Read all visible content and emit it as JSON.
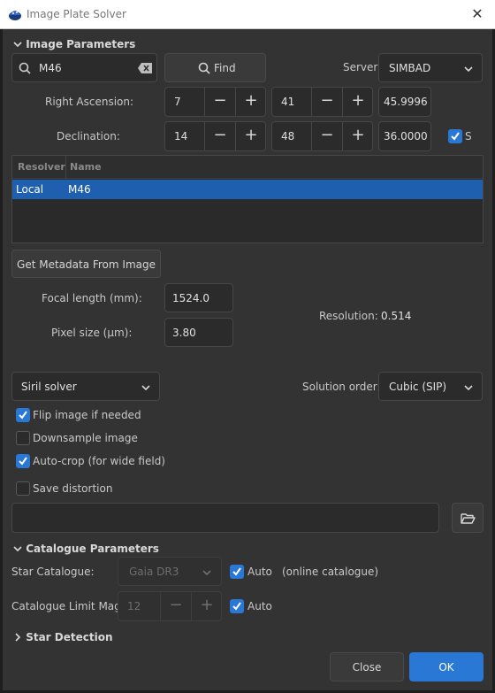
{
  "window": {
    "title": "Image Plate Solver"
  },
  "image_params": {
    "header": "Image Parameters",
    "search_value": "M46",
    "find_label": "Find",
    "server_label": "Server:",
    "server_value": "SIMBAD",
    "ra_label": "Right Ascension:",
    "ra_h": "7",
    "ra_m": "41",
    "ra_s": "45.9996",
    "dec_label": "Declination:",
    "dec_d": "14",
    "dec_m": "48",
    "dec_s": "36.0000",
    "south_label": "S",
    "south_checked": true,
    "table": {
      "columns": [
        "Resolver",
        "Name"
      ],
      "rows": [
        {
          "resolver": "Local",
          "name": "M46"
        }
      ]
    },
    "metadata_button": "Get Metadata From Image",
    "focal_label": "Focal length (mm):",
    "focal_value": "1524.0",
    "pixel_label": "Pixel size (µm):",
    "pixel_value": "3.80",
    "resolution_label": "Resolution:",
    "resolution_value": "0.514"
  },
  "solver": {
    "solver_value": "Siril solver",
    "order_label": "Solution order:",
    "order_value": "Cubic (SIP)",
    "flip_label": "Flip image if needed",
    "flip_checked": true,
    "downsample_label": "Downsample image",
    "downsample_checked": false,
    "autocrop_label": "Auto-crop (for wide field)",
    "autocrop_checked": true,
    "distortion_label": "Save distortion",
    "distortion_checked": false,
    "distortion_path": ""
  },
  "catalogue": {
    "header": "Catalogue Parameters",
    "star_label": "Star Catalogue:",
    "star_value": "Gaia DR3",
    "star_auto_label": "Auto",
    "star_auto_checked": true,
    "online_note": "(online catalogue)",
    "limit_label": "Catalogue Limit Mag:",
    "limit_value": "12",
    "limit_auto_label": "Auto",
    "limit_auto_checked": true
  },
  "star_detection": {
    "header": "Star Detection"
  },
  "buttons": {
    "close": "Close",
    "ok": "OK"
  },
  "colors": {
    "accent": "#2a78d6",
    "background": "#333333",
    "selection": "#1f5fb0"
  }
}
